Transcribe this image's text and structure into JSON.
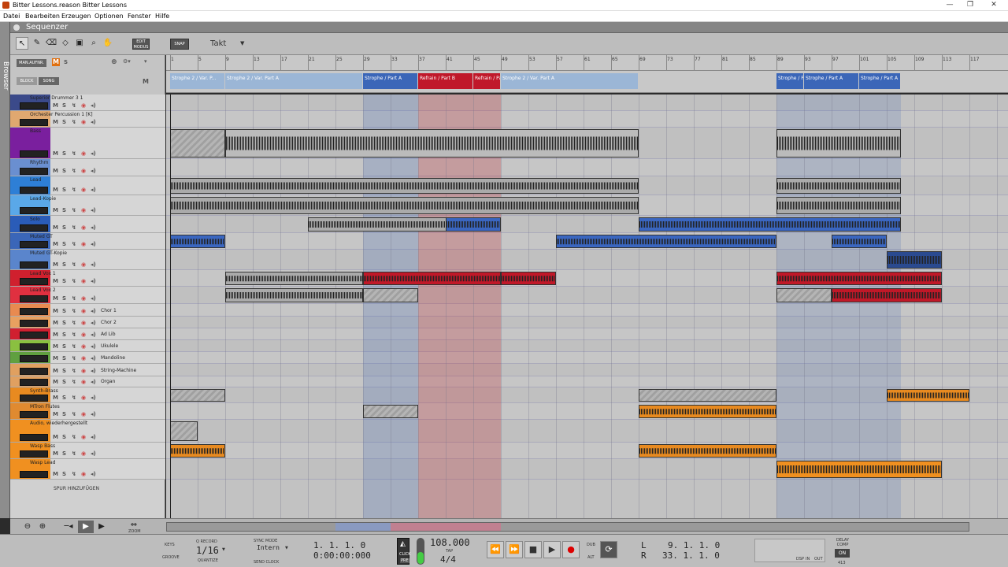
{
  "window": {
    "title": "Bitter Lessons.reason Bitter Lessons"
  },
  "menu": [
    "Datei",
    "Bearbeiten",
    "Erzeugen",
    "Optionen",
    "Fenster",
    "Hilfe"
  ],
  "browser_label": "Browser",
  "sequencer_title": "Sequenzer",
  "toolbar": {
    "edit_mode": "EDIT MODUS",
    "snap": "SNAP",
    "snap_value": "Takt"
  },
  "lefthead": {
    "man_aufnr": "MAN.AUFNR.",
    "m": "M",
    "s": "S",
    "block": "BLOCK",
    "song": "SONG",
    "m2": "M"
  },
  "ruler_ticks": [
    "1",
    "5",
    "9",
    "13",
    "17",
    "21",
    "25",
    "29",
    "33",
    "37",
    "41",
    "45",
    "49",
    "53",
    "57",
    "61",
    "65",
    "69",
    "73",
    "77",
    "81",
    "85",
    "89",
    "93",
    "97",
    "101",
    "105",
    "109",
    "113",
    "117"
  ],
  "blocks": [
    {
      "label": "Strophe 2 / Var. P...",
      "color": "#9bb6d6"
    },
    {
      "label": "Strophe 2 / Var. Part A",
      "color": "#9bb6d6"
    },
    {
      "label": "Strophe / Part A",
      "color": "#3b66b8"
    },
    {
      "label": "Refrain / Part B",
      "color": "#c0182a"
    },
    {
      "label": "Refrain / Part B",
      "color": "#c0182a"
    },
    {
      "label": "Strophe 2 / Var. Part A",
      "color": "#9bb6d6"
    },
    {
      "label": "Strophe / Part A",
      "color": "#3b66b8"
    },
    {
      "label": "Strophe / Part A",
      "color": "#3b66b8"
    },
    {
      "label": "Strophe / Part A",
      "color": "#3b66b8"
    }
  ],
  "tracks": [
    {
      "name": "Superior Drummer 3 1",
      "color": "#3b4a8a",
      "label": ""
    },
    {
      "name": "Orchester Percussion 1 [K]",
      "color": "#e0a870",
      "label": ""
    },
    {
      "name": "Bass",
      "color": "#7a1f9e",
      "label": ""
    },
    {
      "name": "Rhythm",
      "color": "#6a8fd0",
      "label": ""
    },
    {
      "name": "Lead",
      "color": "#2e7fd6",
      "label": ""
    },
    {
      "name": "Lead-Kopie",
      "color": "#5aa8e8",
      "label": ""
    },
    {
      "name": "Solo",
      "color": "#2a5cb8",
      "label": ""
    },
    {
      "name": "Muted GT",
      "color": "#3a66b8",
      "label": ""
    },
    {
      "name": "Muted GT-Kopie",
      "color": "#5a85cc",
      "label": ""
    },
    {
      "name": "Lead Vox 1",
      "color": "#d0202e",
      "label": ""
    },
    {
      "name": "Lead Vox 2",
      "color": "#e03040",
      "label": ""
    },
    {
      "name": "",
      "color": "#e88a50",
      "label": "Chor 1"
    },
    {
      "name": "",
      "color": "#e8a060",
      "label": "Chor 2"
    },
    {
      "name": "",
      "color": "#d02030",
      "label": "Ad Lib"
    },
    {
      "name": "",
      "color": "#8ac040",
      "label": "Ukulele"
    },
    {
      "name": "",
      "color": "#60a040",
      "label": "Mandoline"
    },
    {
      "name": "",
      "color": "#e0a060",
      "label": "String-Machine"
    },
    {
      "name": "",
      "color": "#e0a060",
      "label": "Organ"
    },
    {
      "name": "Synth-Brass",
      "color": "#e88a20",
      "label": ""
    },
    {
      "name": "MTron Flutes",
      "color": "#e08a30",
      "label": ""
    },
    {
      "name": "Audio, wiederhergestellt",
      "color": "#f09020",
      "label": ""
    },
    {
      "name": "Wasp Bass",
      "color": "#f09020",
      "label": ""
    },
    {
      "name": "Wasp Lead",
      "color": "#f09020",
      "label": ""
    }
  ],
  "add_track": "SPUR HINZUFÜGEN",
  "transport": {
    "keys": "KEYS",
    "groove": "GROOVE",
    "q_record": "Q RECORD",
    "quantize": "QUANTIZE",
    "quant_value": "1/16",
    "sync_mode": "SYNC MODE",
    "sync_value": "Intern",
    "send_clock": "SEND CLOCK",
    "position": "1.  1.  1.    0",
    "time": "0:00:00:000",
    "click": "CLICK",
    "pre": "PRE",
    "tempo": "108.000",
    "tap": "TAP",
    "signature": "4/4",
    "dub": "DUB",
    "alt": "ALT",
    "l_label": "L",
    "r_label": "R",
    "l_pos": "9.  1.  1.    0",
    "r_pos": "33.  1.  1.    0",
    "delay_comp": "DELAY COMP",
    "on": "ON",
    "value_413": "413",
    "dsp": "DSP",
    "in": "IN",
    "out": "OUT",
    "zoom": "ZOOM"
  }
}
